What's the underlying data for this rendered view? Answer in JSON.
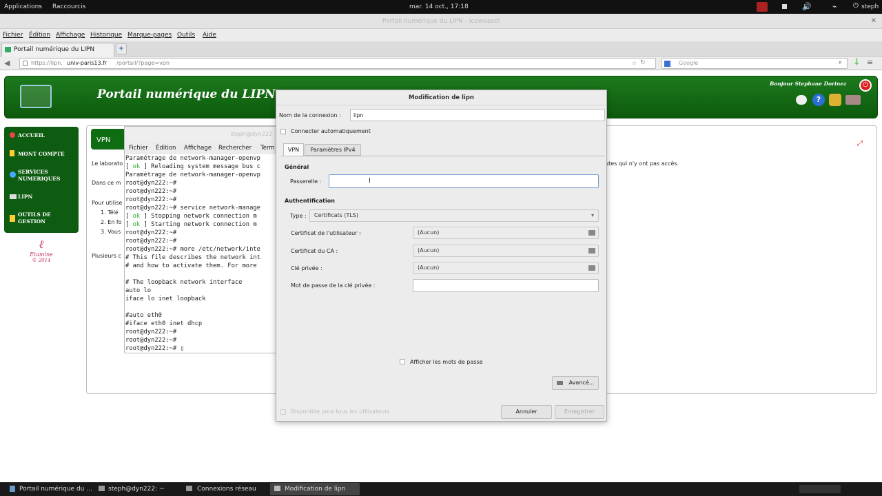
{
  "topbar": {
    "applications": "Applications",
    "shortcuts": "Raccourcis",
    "clock": "mar. 14 oct., 17:18",
    "user": "steph"
  },
  "window_title": "Portail numérique du LIPN - Iceweasel",
  "menu": [
    "Fichier",
    "Édition",
    "Affichage",
    "Historique",
    "Marque-pages",
    "Outils",
    "Aide"
  ],
  "tab": {
    "label": "Portail numérique du LIPN",
    "new_tab": "+"
  },
  "url": {
    "prefix": "https://lipn.",
    "domain": "univ-paris13.fr",
    "path": "/portail/?page=vpn"
  },
  "search": {
    "engine": "Google"
  },
  "banner": {
    "title": "Portail numérique du LIPN",
    "greeting": "Bonjour Stephane Dorinez"
  },
  "sidebar": {
    "items": [
      "ACCUEIL",
      "MONT COMPTE",
      "SERVICES NUMERIQUES",
      "LIPN",
      "OUTILS DE GESTION"
    ],
    "logo": "Etamine",
    "logo_year": "© 2014"
  },
  "content": {
    "tab_label": "VPN",
    "lines": [
      "Le laborato",
      "Dans ce m",
      "Pour utilise",
      "Télé",
      "En fo",
      "Vous",
      "Plusieurs c"
    ],
    "right_text": "utes qui n'y ont pas accès."
  },
  "terminal": {
    "title": "steph@dyn222",
    "menu": [
      "Fichier",
      "Édition",
      "Affichage",
      "Rechercher",
      "Term"
    ],
    "lines": [
      "Paramétrage de network-manager-openvp",
      "[ ok ] Reloading system message bus c",
      "Paramétrage de network-manager-openvp",
      "root@dyn222:~#",
      "root@dyn222:~#",
      "root@dyn222:~#",
      "root@dyn222:~# service network-manage",
      "[ ok ] Stopping network connection m",
      "[ ok ] Starting network connection m",
      "root@dyn222:~#",
      "root@dyn222:~#",
      "root@dyn222:~# more /etc/network/inte",
      "# This file describes the network int",
      "# and how to activate them. For more",
      "",
      "# The loopback network interface",
      "auto lo",
      "iface lo inet loopback",
      "",
      "#auto eth0",
      "#iface eth0 inet dhcp",
      "root@dyn222:~#",
      "root@dyn222:~#",
      "root@dyn222:~# ▯"
    ]
  },
  "dialog": {
    "title": "Modification de lipn",
    "conn_name_label": "Nom de la connexion :",
    "conn_name_value": "lipn",
    "auto_connect": "Connecter automatiquement",
    "tabs": [
      "VPN",
      "Paramètres IPv4"
    ],
    "general": "Général",
    "gateway_label": "Passerelle :",
    "gateway_value": "",
    "auth": "Authentification",
    "type_label": "Type :",
    "type_value": "Certificats (TLS)",
    "user_cert_label": "Certificat de l'utilisateur :",
    "user_cert_value": "(Aucun)",
    "ca_cert_label": "Certificat du CA :",
    "ca_cert_value": "(Aucun)",
    "private_key_label": "Clé privée :",
    "private_key_value": "(Aucun)",
    "key_password_label": "Mot de passe de la clé privée :",
    "show_passwords": "Afficher les mots de passe",
    "advanced": "Avancé...",
    "all_users": "Disponible pour tous les utilisateurs",
    "cancel": "Annuler",
    "save": "Enregistrer"
  },
  "taskbar": [
    "Portail numérique du ...",
    "steph@dyn222: ~",
    "Connexions réseau",
    "Modification de lipn"
  ]
}
